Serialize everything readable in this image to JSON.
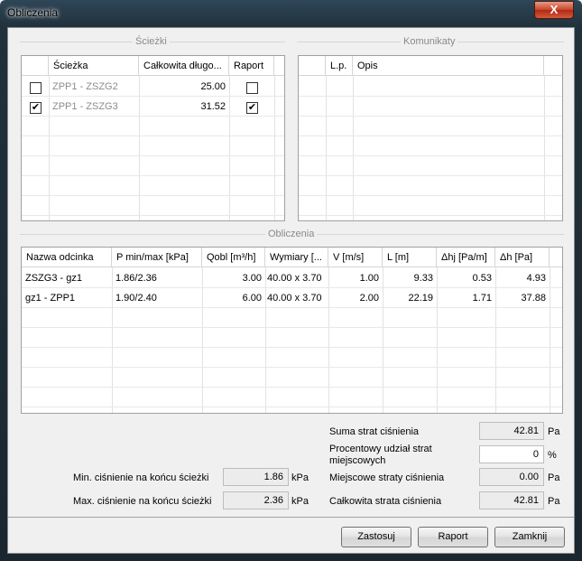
{
  "window": {
    "title": "Obliczenia",
    "close_glyph": "X"
  },
  "paths_group": {
    "title": "Ścieżki",
    "columns": [
      "",
      "Ścieżka",
      "Całkowita długo...",
      "Raport"
    ],
    "rows": [
      {
        "checked": "",
        "name": "ZPP1 - ZSZG2",
        "length": "25.00",
        "report": ""
      },
      {
        "checked": "✔",
        "name": "ZPP1 - ZSZG3",
        "length": "31.52",
        "report": "✔"
      }
    ]
  },
  "messages_group": {
    "title": "Komunikaty",
    "columns": [
      "",
      "L.p.",
      "Opis"
    ]
  },
  "calc_group": {
    "title": "Obliczenia",
    "columns": [
      "Nazwa odcinka",
      "P min/max [kPa]",
      "Qobl [m³/h]",
      "Wymiary [...",
      "V [m/s]",
      "L [m]",
      "Δhj [Pa/m]",
      "Δh [Pa]"
    ],
    "rows": [
      {
        "name": "ZSZG3 - gz1",
        "p": "1.86/2.36",
        "q": "3.00",
        "dim": "40.00 x 3.70",
        "v": "1.00",
        "l": "9.33",
        "dhj": "0.53",
        "dh": "4.93"
      },
      {
        "name": "gz1 - ZPP1",
        "p": "1.90/2.40",
        "q": "6.00",
        "dim": "40.00 x 3.70",
        "v": "2.00",
        "l": "22.19",
        "dhj": "1.71",
        "dh": "37.88"
      }
    ]
  },
  "summary": {
    "min_label": "Min. ciśnienie na końcu ścieżki",
    "min_value": "1.86",
    "min_unit": "kPa",
    "max_label": "Max. ciśnienie na końcu ścieżki",
    "max_value": "2.36",
    "max_unit": "kPa",
    "sum_label": "Suma strat ciśnienia",
    "sum_value": "42.81",
    "sum_unit": "Pa",
    "percent_label": "Procentowy udział strat miejscowych",
    "percent_value": "0",
    "percent_unit": "%",
    "local_label": "Miejscowe straty ciśnienia",
    "local_value": "0.00",
    "local_unit": "Pa",
    "total_label": "Całkowita strata ciśnienia",
    "total_value": "42.81",
    "total_unit": "Pa"
  },
  "buttons": {
    "apply": "Zastosuj",
    "report": "Raport",
    "close": "Zamknij"
  }
}
